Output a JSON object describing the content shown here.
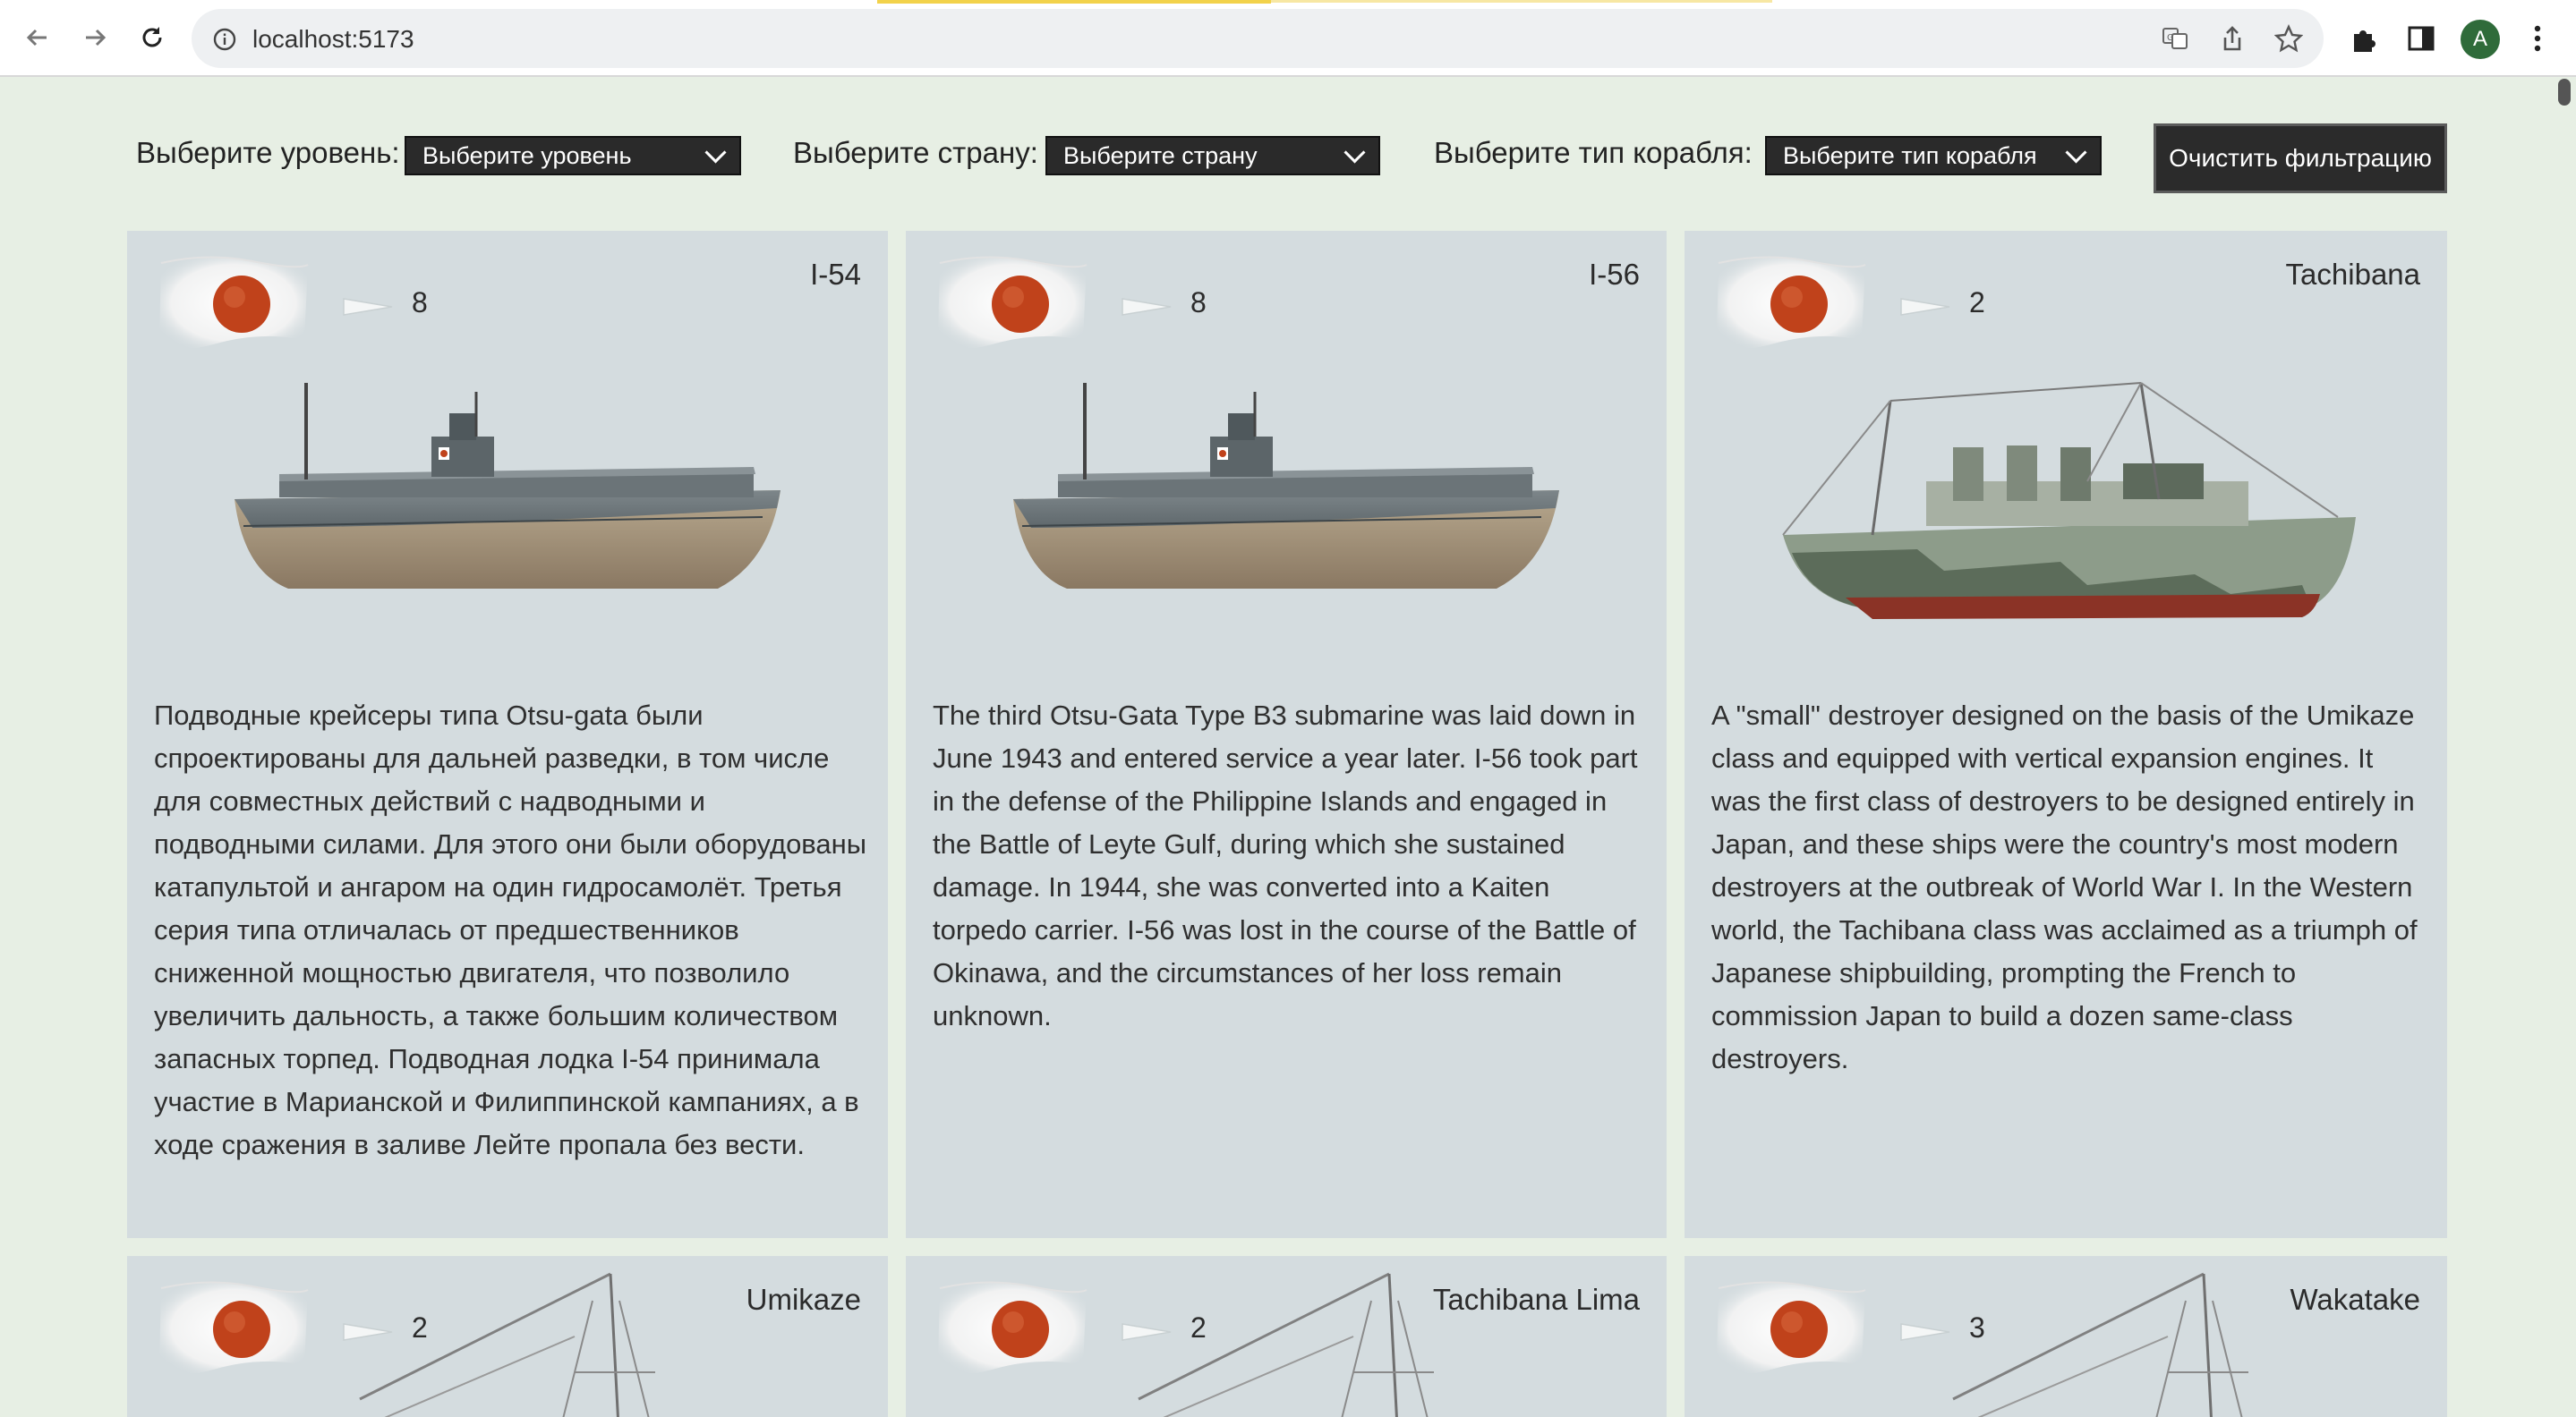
{
  "browser": {
    "url": "localhost:5173",
    "profile_initial": "A",
    "icons": [
      "back-icon",
      "forward-icon",
      "reload-icon",
      "info-icon",
      "translate-icon",
      "share-icon",
      "bookmark-star-icon",
      "extensions-icon",
      "side-panel-icon",
      "menu-kebab-icon"
    ]
  },
  "filters": {
    "level_label": "Выберите уровень:",
    "level_value": "Выберите уровень",
    "country_label": "Выберите страну:",
    "country_value": "Выберите страну",
    "type_label": "Выберите тип корабля:",
    "type_value": "Выберите тип корабля",
    "clear_button": "Очистить фильтрацию"
  },
  "colors": {
    "page_bg": "#e7efe4",
    "card_bg": "#d4dcdf",
    "select_bg": "#2a2a2a",
    "flag_red": "#c0421b"
  },
  "cards": [
    {
      "name": "I-54",
      "tier": "8",
      "ship_kind": "submarine",
      "description": "Подводные крейсеры типа Otsu-gata были спроектированы для дальней разведки, в том числе для совместных действий с надводными и подводными силами. Для этого они были оборудованы катапультой и ангаром на один гидросамолёт. Третья серия типа отличалась от предшественников сниженной мощностью двигателя, что позволило увеличить дальность, а также большим количеством запасных торпед. Подводная лодка I-54 принимала участие в Марианской и Филиппинской кампаниях, а в ходе сражения в заливе Лейте пропала без вести."
    },
    {
      "name": "I-56",
      "tier": "8",
      "ship_kind": "submarine",
      "description": "The third Otsu-Gata Type B3 submarine was laid down in June 1943 and entered service a year later. I-56 took part in the defense of the Philippine Islands and engaged in the Battle of Leyte Gulf, during which she sustained damage. In 1944, she was converted into a Kaiten torpedo carrier. I-56 was lost in the course of the Battle of Okinawa, and the circumstances of her loss remain unknown."
    },
    {
      "name": "Tachibana",
      "tier": "2",
      "ship_kind": "destroyer",
      "description": "A \"small\" destroyer designed on the basis of the Umikaze class and equipped with vertical expansion engines. It was the first class of destroyers to be designed entirely in Japan, and these ships were the country's most modern destroyers at the outbreak of World War I. In the Western world, the Tachibana class was acclaimed as a triumph of Japanese shipbuilding, prompting the French to commission Japan to build a dozen same-class destroyers."
    },
    {
      "name": "Umikaze",
      "tier": "2",
      "ship_kind": "destroyer",
      "description": ""
    },
    {
      "name": "Tachibana Lima",
      "tier": "2",
      "ship_kind": "destroyer",
      "description": ""
    },
    {
      "name": "Wakatake",
      "tier": "3",
      "ship_kind": "destroyer",
      "description": ""
    }
  ]
}
